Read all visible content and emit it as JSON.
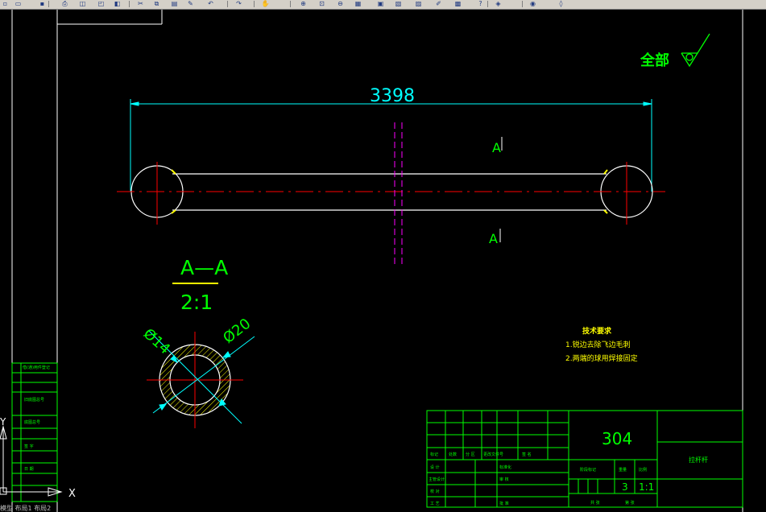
{
  "toolbar": {
    "buttons": [
      "new-file-icon",
      "open-icon",
      "save-icon",
      "print-icon",
      "preview-icon",
      "publish-icon",
      "plot-icon",
      "cut-icon",
      "copy-icon",
      "paste-icon",
      "match-props-icon",
      "undo-icon",
      "redo-icon",
      "pan-icon",
      "zoom-realtime-icon",
      "zoom-window-icon",
      "zoom-previous-icon",
      "properties-icon",
      "design-center-icon",
      "tool-palettes-icon",
      "sheet-set-icon",
      "markup-icon",
      "calculator-icon",
      "help-icon",
      "layer-icon",
      "layer-state-icon",
      "layer-prev-icon"
    ]
  },
  "drawing": {
    "dimension_length": "3398",
    "section_marker_top": "A",
    "section_marker_bottom": "A",
    "roughness_label": "全部",
    "section_title": "A—A",
    "section_scale": "2:1",
    "dim_inner": "Ø14",
    "dim_outer": "Ø20",
    "tech_title": "技术要求",
    "tech_line1": "1.锐边去除飞边毛刺",
    "tech_line2": "2.两端的球用焊接固定"
  },
  "title_block": {
    "drawing_number": "304",
    "part_name": "拉杆杆",
    "quantity": "3",
    "scale": "1:1",
    "cells": {
      "mark": "标记",
      "count": "处数",
      "zone": "分 区",
      "change_doc": "更改文件号",
      "sign": "签 名",
      "designer": "设 计",
      "standardize": "标准化",
      "stage_mark": "阶段标记",
      "weight": "重量",
      "ratio": "比例",
      "main_design": "主管设计",
      "review": "审 核",
      "proof": "校 对",
      "process": "工 艺",
      "approve": "批 准",
      "sheet_total": "共 张",
      "sheet_no": "第 张"
    }
  },
  "left_strip": {
    "labels": [
      "借(通)用件登记",
      "旧底图总号",
      "底图总号",
      "签 字",
      "日 期"
    ]
  },
  "ucs": {
    "x_label": "X",
    "y_label": "Y"
  },
  "tabs": [
    "模型",
    "布局1",
    "布局2"
  ],
  "colors": {
    "background": "#000000",
    "dimension": "#00ffff",
    "text_green": "#00ff00",
    "center_red": "#ff0000",
    "magenta": "#ff00ff",
    "yellow": "#ffff00",
    "white": "#ffffff",
    "tech_yellow": "#ffff00"
  }
}
